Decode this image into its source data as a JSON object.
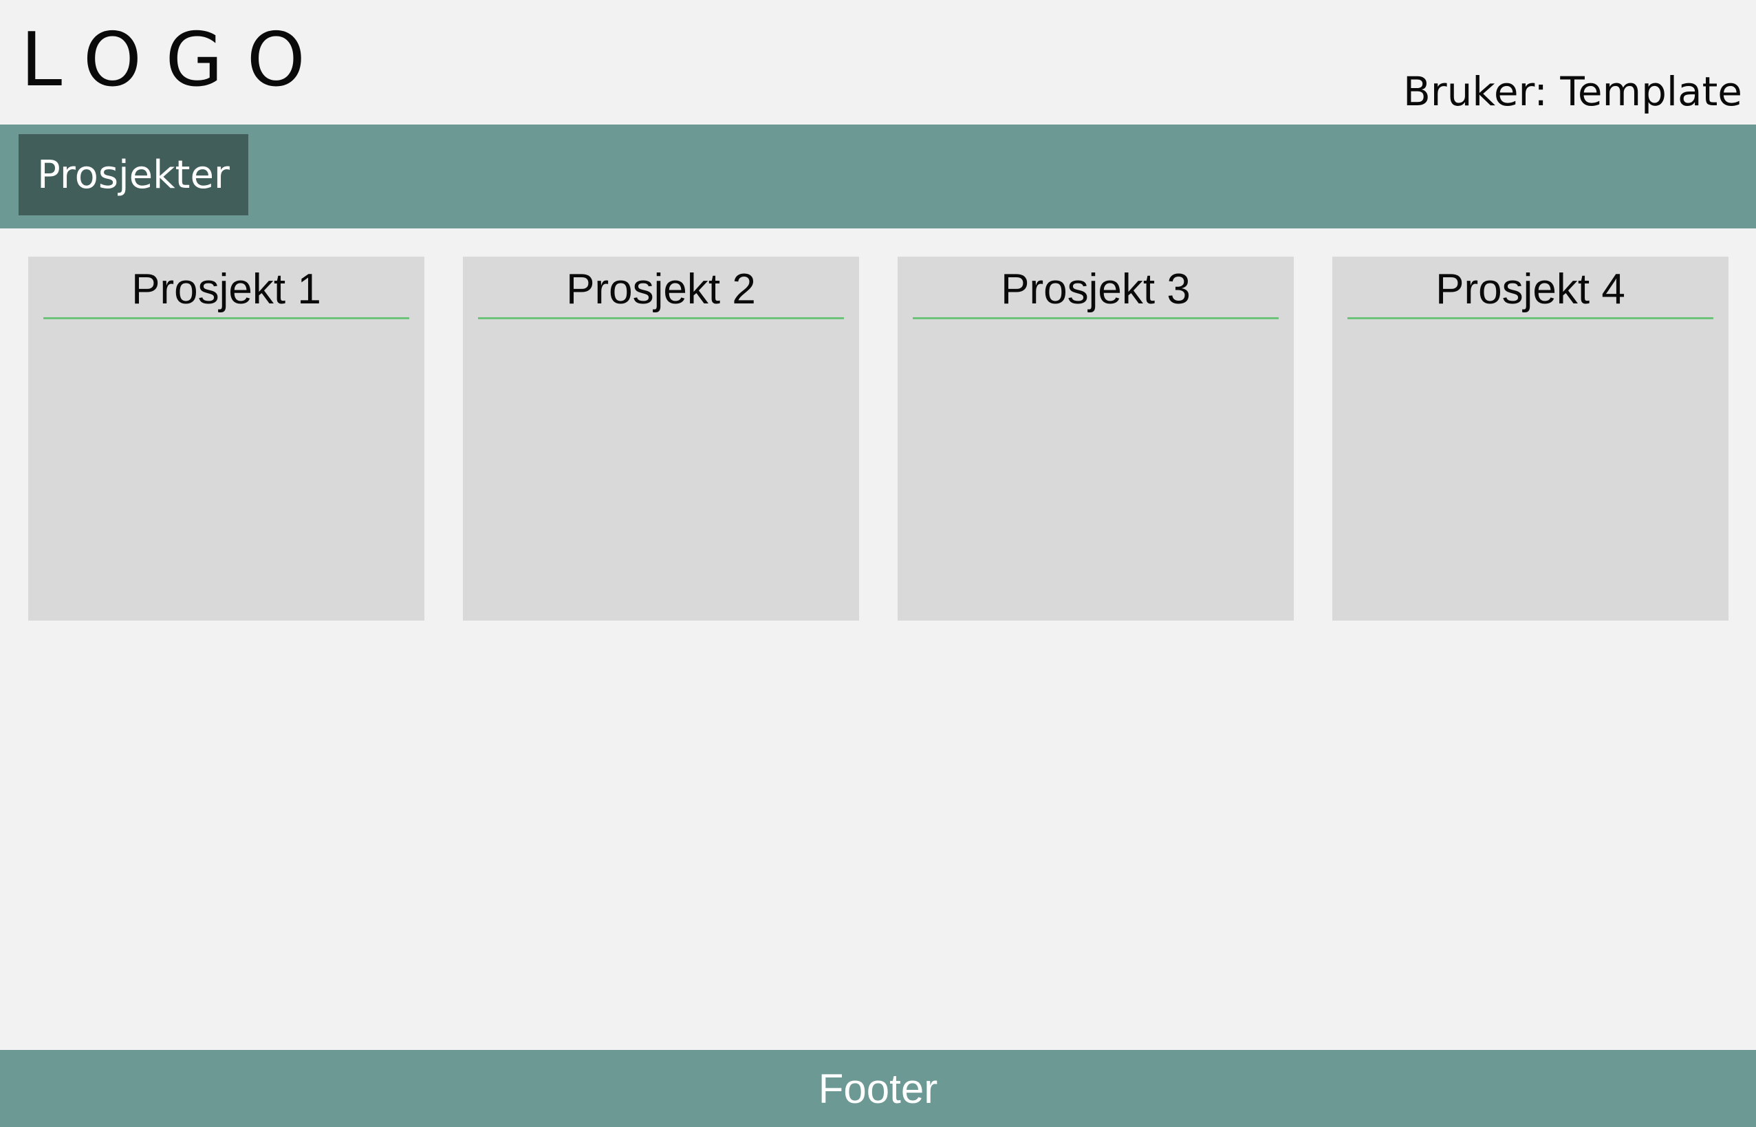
{
  "header": {
    "logo": "LOGO",
    "user_label": "Bruker: Template"
  },
  "nav": {
    "tabs": [
      {
        "label": "Prosjekter",
        "active": true
      }
    ]
  },
  "projects": [
    {
      "title": "Prosjekt 1"
    },
    {
      "title": "Prosjekt 2"
    },
    {
      "title": "Prosjekt 3"
    },
    {
      "title": "Prosjekt 4"
    }
  ],
  "footer": {
    "label": "Footer"
  },
  "colors": {
    "background": "#f2f2f2",
    "nav_bar": "#6d9995",
    "nav_tab_active": "#415e5b",
    "card": "#d9d9d9",
    "card_divider": "#6cc37a"
  }
}
